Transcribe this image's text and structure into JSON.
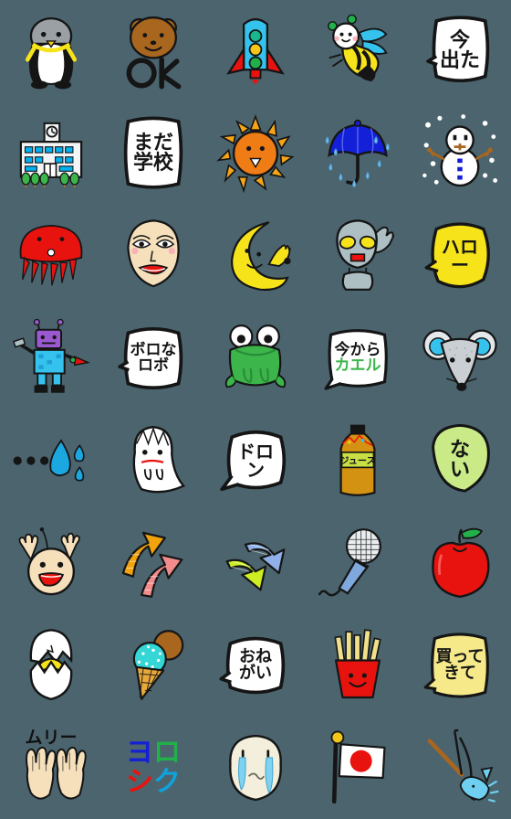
{
  "meta": {
    "title": "Emoji sticker sheet",
    "background_color": "#4b646e",
    "columns": 5,
    "rows": 8,
    "cell_size_px": 112,
    "canvas": "560x896"
  },
  "palette": {
    "ink": "#151515",
    "white": "#ffffff",
    "yellow": "#f7e319",
    "red": "#e8130f",
    "blue": "#1320d8",
    "cyan": "#35c3ee",
    "green": "#3cb54a",
    "orange": "#f07c15",
    "skin": "#f5ddb3",
    "gray": "#9aa0a3",
    "brown": "#a8661f",
    "lightgreen": "#c9ea86",
    "lightyellow": "#f6e98a"
  },
  "stickers": [
    {
      "id": 1,
      "row": 1,
      "col": 1,
      "name": "penguin",
      "text": "",
      "lines": [],
      "colors": [
        "#9aa0a3",
        "#f7e319",
        "#ffffff",
        "#151515"
      ]
    },
    {
      "id": 2,
      "row": 1,
      "col": 2,
      "name": "bear-ok",
      "text": "OK",
      "lines": [
        "OK"
      ],
      "colors": [
        "#a8661f",
        "#151515"
      ]
    },
    {
      "id": 3,
      "row": 1,
      "col": 3,
      "name": "rocket-traffic-light",
      "text": "",
      "lines": [],
      "colors": [
        "#e8130f",
        "#35c3ee",
        "#22b04a",
        "#f5c518"
      ]
    },
    {
      "id": 4,
      "row": 1,
      "col": 4,
      "name": "bee",
      "text": "",
      "lines": [],
      "colors": [
        "#f7e319",
        "#151515",
        "#35c3ee",
        "#22b04a"
      ]
    },
    {
      "id": 5,
      "row": 1,
      "col": 5,
      "name": "speech-just-left",
      "text": "今出た",
      "lines": [
        "今",
        "出た"
      ],
      "colors": [
        "#ffffff",
        "#151515"
      ]
    },
    {
      "id": 6,
      "row": 2,
      "col": 1,
      "name": "school-building",
      "text": "",
      "lines": [],
      "colors": [
        "#ffffff",
        "#00b0f0",
        "#3cb54a"
      ]
    },
    {
      "id": 7,
      "row": 2,
      "col": 2,
      "name": "speech-still-school",
      "text": "まだ学校",
      "lines": [
        "まだ",
        "学校"
      ],
      "colors": [
        "#ffffff",
        "#151515"
      ]
    },
    {
      "id": 8,
      "row": 2,
      "col": 3,
      "name": "sun-face",
      "text": "",
      "lines": [],
      "colors": [
        "#f07c15",
        "#f5c518"
      ]
    },
    {
      "id": 9,
      "row": 2,
      "col": 4,
      "name": "umbrella-rain",
      "text": "",
      "lines": [],
      "colors": [
        "#1320d8",
        "#6fb8e8"
      ]
    },
    {
      "id": 10,
      "row": 2,
      "col": 5,
      "name": "snowman",
      "text": "",
      "lines": [],
      "colors": [
        "#ffffff",
        "#1320d8",
        "#a8661f"
      ]
    },
    {
      "id": 11,
      "row": 3,
      "col": 1,
      "name": "red-jellyfish",
      "text": "",
      "lines": [],
      "colors": [
        "#e8130f",
        "#151515"
      ]
    },
    {
      "id": 12,
      "row": 3,
      "col": 2,
      "name": "face-lady",
      "text": "",
      "lines": [],
      "colors": [
        "#f5ddb3",
        "#e8130f"
      ]
    },
    {
      "id": 13,
      "row": 3,
      "col": 3,
      "name": "crescent-moon-waving",
      "text": "",
      "lines": [],
      "colors": [
        "#f7e319",
        "#151515"
      ]
    },
    {
      "id": 14,
      "row": 3,
      "col": 4,
      "name": "alien-waving",
      "text": "",
      "lines": [],
      "colors": [
        "#aebfc4",
        "#f7e319",
        "#e8130f"
      ]
    },
    {
      "id": 15,
      "row": 3,
      "col": 5,
      "name": "speech-hello",
      "text": "ハロー",
      "lines": [
        "ハロ",
        "ー"
      ],
      "colors": [
        "#f7e319",
        "#151515"
      ]
    },
    {
      "id": 16,
      "row": 4,
      "col": 1,
      "name": "robot-character",
      "text": "",
      "lines": [],
      "colors": [
        "#9b59d0",
        "#35c3ee",
        "#e8130f"
      ]
    },
    {
      "id": 17,
      "row": 4,
      "col": 2,
      "name": "speech-broken-robot",
      "text": "ボロなロボ",
      "lines": [
        "ボロな",
        "ロボ"
      ],
      "colors": [
        "#ffffff",
        "#151515"
      ]
    },
    {
      "id": 18,
      "row": 4,
      "col": 3,
      "name": "frog",
      "text": "",
      "lines": [],
      "colors": [
        "#3cb54a",
        "#ffffff"
      ]
    },
    {
      "id": 19,
      "row": 4,
      "col": 4,
      "name": "speech-going-home",
      "text": "今からカエル",
      "lines": [
        "今から",
        "カエル"
      ],
      "colors": [
        "#ffffff",
        "#151515",
        "#3cb54a"
      ]
    },
    {
      "id": 20,
      "row": 4,
      "col": 5,
      "name": "mouse-face",
      "text": "",
      "lines": [],
      "colors": [
        "#cfd4d6",
        "#35c3ee",
        "#151515"
      ]
    },
    {
      "id": 21,
      "row": 5,
      "col": 1,
      "name": "sweat-drop-dots",
      "text": "",
      "lines": [],
      "colors": [
        "#1ba8e0",
        "#151515"
      ]
    },
    {
      "id": 22,
      "row": 5,
      "col": 2,
      "name": "ghost",
      "text": "",
      "lines": [],
      "colors": [
        "#ffffff",
        "#e8130f",
        "#151515"
      ]
    },
    {
      "id": 23,
      "row": 5,
      "col": 3,
      "name": "speech-doron",
      "text": "ドロン",
      "lines": [
        "ドロ",
        "ン"
      ],
      "colors": [
        "#ffffff",
        "#151515"
      ]
    },
    {
      "id": 24,
      "row": 5,
      "col": 4,
      "name": "juice-bottle",
      "text": "ジュース",
      "lines": [
        "ジュース"
      ],
      "colors": [
        "#d39211",
        "#c8e043"
      ]
    },
    {
      "id": 25,
      "row": 5,
      "col": 5,
      "name": "speech-none",
      "text": "ない",
      "lines": [
        "な",
        "い"
      ],
      "colors": [
        "#c9ea86",
        "#151515"
      ]
    },
    {
      "id": 26,
      "row": 6,
      "col": 1,
      "name": "baby-face-arms-up",
      "text": "",
      "lines": [],
      "colors": [
        "#f5ddb3",
        "#e8130f"
      ]
    },
    {
      "id": 27,
      "row": 6,
      "col": 2,
      "name": "up-arrows-orange-pink",
      "text": "",
      "lines": [],
      "colors": [
        "#f0a30a",
        "#f28c8c"
      ]
    },
    {
      "id": 28,
      "row": 6,
      "col": 3,
      "name": "down-arrows-blue-green",
      "text": "",
      "lines": [],
      "colors": [
        "#8fb0e8",
        "#ccee22"
      ]
    },
    {
      "id": 29,
      "row": 6,
      "col": 4,
      "name": "microphone",
      "text": "",
      "lines": [],
      "colors": [
        "#7fa9dd",
        "#ffffff"
      ]
    },
    {
      "id": 30,
      "row": 6,
      "col": 5,
      "name": "apple",
      "text": "",
      "lines": [],
      "colors": [
        "#e8130f",
        "#3cb54a"
      ]
    },
    {
      "id": 31,
      "row": 7,
      "col": 1,
      "name": "chick-hatching",
      "text": "",
      "lines": [],
      "colors": [
        "#ffffff",
        "#f7e319"
      ]
    },
    {
      "id": 32,
      "row": 7,
      "col": 2,
      "name": "ice-cream-cone",
      "text": "",
      "lines": [],
      "colors": [
        "#35d6d6",
        "#a8661f",
        "#e8a93a"
      ]
    },
    {
      "id": 33,
      "row": 7,
      "col": 3,
      "name": "speech-please",
      "text": "おねがい",
      "lines": [
        "おね",
        "がい"
      ],
      "colors": [
        "#ffffff",
        "#151515"
      ]
    },
    {
      "id": 34,
      "row": 7,
      "col": 4,
      "name": "french-fries",
      "text": "",
      "lines": [],
      "colors": [
        "#e8130f",
        "#f0e08a"
      ]
    },
    {
      "id": 35,
      "row": 7,
      "col": 5,
      "name": "speech-buy-it",
      "text": "買ってきて",
      "lines": [
        "買って",
        "きて"
      ],
      "colors": [
        "#f6e98a",
        "#151515"
      ]
    },
    {
      "id": 36,
      "row": 8,
      "col": 1,
      "name": "hands-impossible",
      "text": "ムリー",
      "lines": [
        "ムリー"
      ],
      "colors": [
        "#f5ddb3",
        "#151515"
      ]
    },
    {
      "id": 37,
      "row": 8,
      "col": 2,
      "name": "yoroshiku-text",
      "text": "ヨロシク",
      "lines": [
        "ヨロ",
        "シク"
      ],
      "colors": [
        "#1320d8",
        "#22b04a",
        "#e8130f",
        "#0fa2dd"
      ]
    },
    {
      "id": 38,
      "row": 8,
      "col": 3,
      "name": "crying-face",
      "text": "",
      "lines": [],
      "colors": [
        "#f3efdc",
        "#35c3ee"
      ]
    },
    {
      "id": 39,
      "row": 8,
      "col": 4,
      "name": "japan-flag",
      "text": "",
      "lines": [],
      "colors": [
        "#ffffff",
        "#e8130f",
        "#f5c518"
      ]
    },
    {
      "id": 40,
      "row": 8,
      "col": 5,
      "name": "fishing-rod-fish",
      "text": "",
      "lines": [],
      "colors": [
        "#a8661f",
        "#35c3ee",
        "#151515"
      ]
    }
  ],
  "captions": {
    "s5_l1": "今",
    "s5_l2": "出た",
    "s7_l1": "まだ",
    "s7_l2": "学校",
    "s15_l1": "ハロ",
    "s15_l2": "ー",
    "s17_l1": "ボロな",
    "s17_l2": "ロボ",
    "s19_l1": "今から",
    "s19_l2": "カエル",
    "s23_l1": "ドロ",
    "s23_l2": "ン",
    "s24_l1": "ジュース",
    "s25_l1": "な",
    "s25_l2": "い",
    "s33_l1": "おね",
    "s33_l2": "がい",
    "s35_l1": "買って",
    "s35_l2": "きて",
    "s36_l1": "ムリー",
    "s37_c1": "ヨ",
    "s37_c2": "ロ",
    "s37_c3": "シ",
    "s37_c4": "ク",
    "s2_ok": "OK"
  }
}
